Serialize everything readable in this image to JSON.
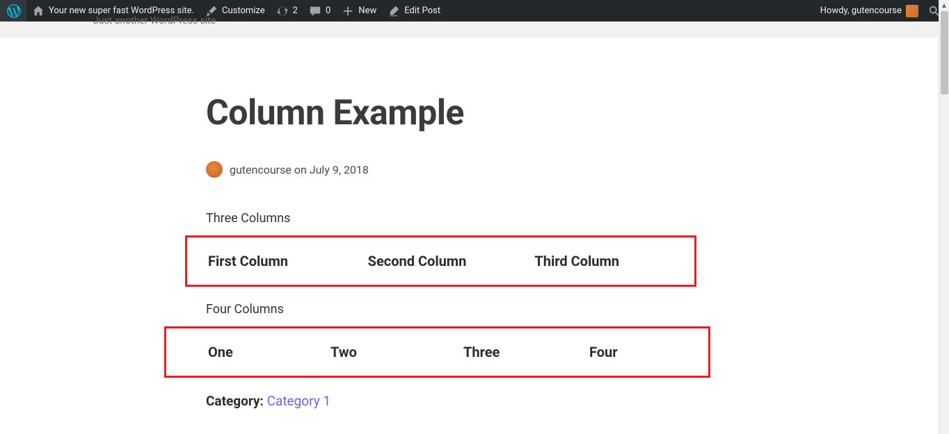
{
  "adminbar": {
    "site_name": "Your new super fast WordPress site.",
    "customize": "Customize",
    "updates_count": "2",
    "comments_count": "0",
    "new_label": "New",
    "edit_post": "Edit Post",
    "howdy_prefix": "Howdy, ",
    "user": "gutencourse"
  },
  "tagline": "Just another WordPress site",
  "post": {
    "title": "Column Example",
    "author": "gutencourse",
    "byline_sep": " on ",
    "date": "July 9, 2018",
    "three_label": "Three Columns",
    "three_cols": {
      "c1": "First Column",
      "c2": "Second Column",
      "c3": "Third Column"
    },
    "four_label": "Four Columns",
    "four_cols": {
      "c1": "One",
      "c2": "Two",
      "c3": "Three",
      "c4": "Four"
    },
    "category_label": "Category: ",
    "category_link": "Category 1"
  }
}
